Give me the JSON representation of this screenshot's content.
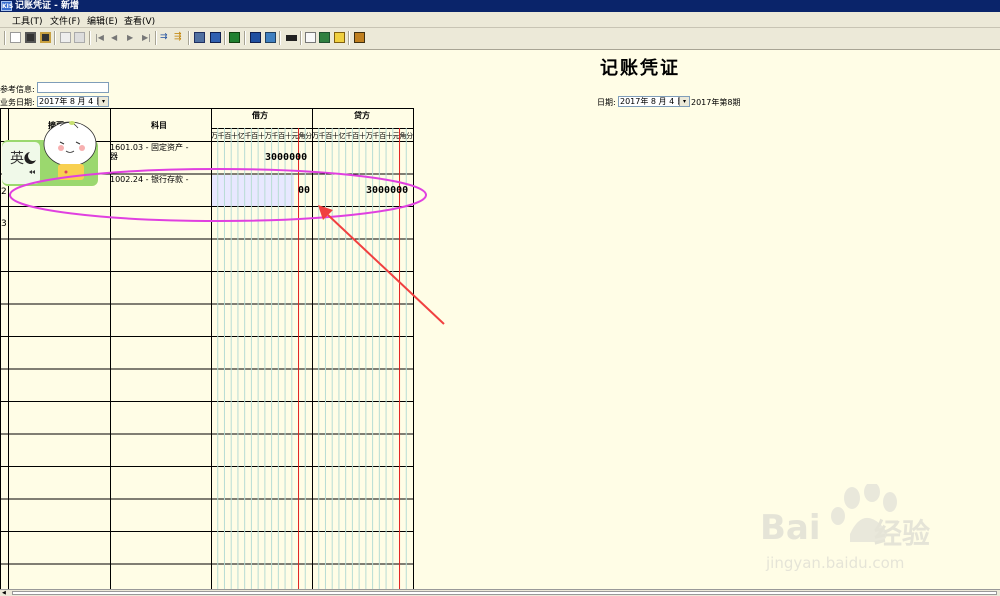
{
  "window": {
    "title": "记账凭证 - 新增"
  },
  "app_icon_label": "KIS",
  "menu": [
    {
      "label": "工具(T)"
    },
    {
      "label": "文件(F)"
    },
    {
      "label": "编辑(E)"
    },
    {
      "label": "查看(V)"
    }
  ],
  "document": {
    "title": "记账凭证"
  },
  "form": {
    "reference_label": "参考信息:",
    "reference_value": "",
    "business_date_label": "业务日期:",
    "business_date_value": "2017年 8 月 4 日",
    "date_label": "日期:",
    "date_value": "2017年 8 月 4 日",
    "period_text": "2017年第8期"
  },
  "table": {
    "headers": {
      "summary": "摘要",
      "account": "科目",
      "debit": "借方",
      "credit": "贷方"
    },
    "digit_labels": [
      "万",
      "千",
      "百",
      "十",
      "亿",
      "千",
      "百",
      "十",
      "万",
      "千",
      "百",
      "十",
      "元",
      "角",
      "分"
    ],
    "rows": [
      {
        "num": "1",
        "account": "1601.03 - 固定资产 - ",
        "account_line2": "器",
        "debit": "3000000",
        "credit": ""
      },
      {
        "num": "2",
        "account": "1002.24 - 银行存款 - ",
        "account_line2": "",
        "debit": "00",
        "credit": "3000000"
      },
      {
        "num": "3",
        "account": "",
        "account_line2": "",
        "debit": "",
        "credit": ""
      }
    ]
  },
  "sticker": {
    "text": "英"
  },
  "watermark": {
    "brand": "Bai",
    "brand_cn": "经验",
    "url": "jingyan.baidu.com"
  },
  "colors": {
    "title_bar": "#0a246a",
    "background": "#fffde6",
    "annotation": "#e040e0",
    "arrow": "#f04040",
    "unit_line": "#e02020"
  }
}
